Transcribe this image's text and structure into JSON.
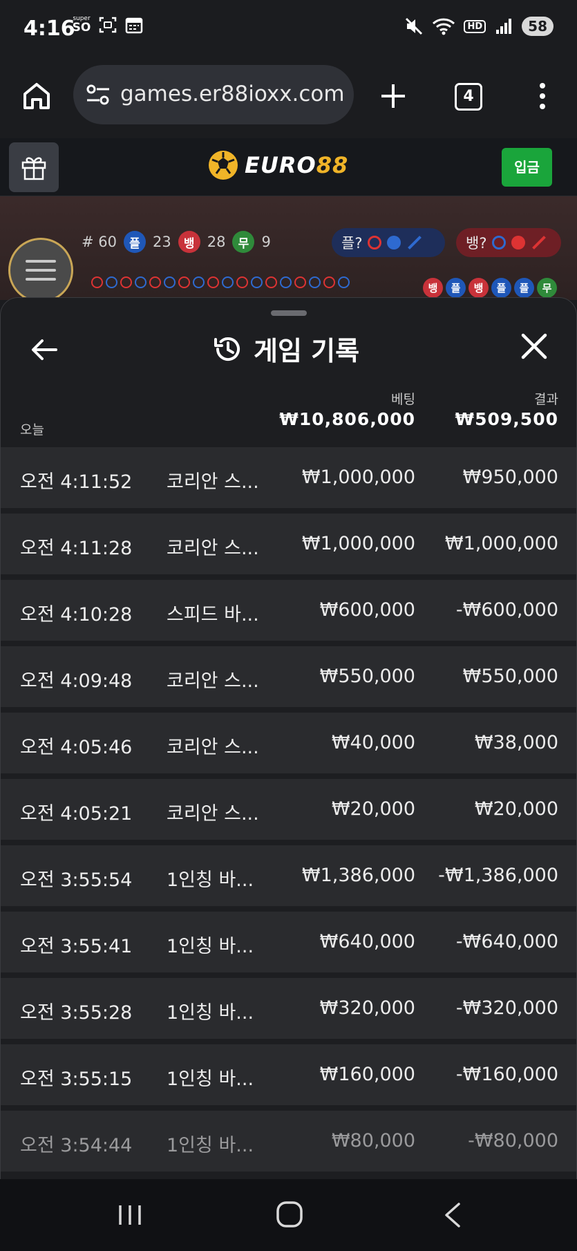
{
  "status": {
    "time": "4:16",
    "battery": "58",
    "hd": "HD",
    "super_label": "super",
    "icons": [
      "super-so-icon",
      "screenshot-icon",
      "calendar-icon",
      "mute-icon",
      "wifi-icon",
      "hd-icon",
      "signal-icon"
    ]
  },
  "browser": {
    "url": "games.er88ioxx.com",
    "tab_count": "4",
    "icons": [
      "home-icon",
      "site-settings-icon",
      "plus-icon",
      "more-vert-icon"
    ]
  },
  "site": {
    "logo_euro": "EURO",
    "logo_num": "88",
    "deposit_label": "입금",
    "colors": {
      "brand_gold": "#f0b428",
      "deposit_green": "#1aa53b"
    }
  },
  "game_strip": {
    "round": "# 60",
    "player_letter": "플",
    "player_count": "23",
    "banker_letter": "뱅",
    "banker_count": "28",
    "tie_letter": "무",
    "tie_count": "9",
    "player_predict": "플?",
    "banker_predict": "뱅?",
    "history_chips": [
      "뱅",
      "플",
      "뱅",
      "플",
      "플",
      "무"
    ]
  },
  "sheet": {
    "title": "게임 기록",
    "today_label": "오늘",
    "bet_header": "베팅",
    "result_header": "결과",
    "bet_total": "₩10,806,000",
    "result_total": "₩509,500",
    "rows": [
      {
        "time": "오전 4:11:52",
        "game": "코리안 스...",
        "bet": "₩1,000,000",
        "result": "₩950,000"
      },
      {
        "time": "오전 4:11:28",
        "game": "코리안 스...",
        "bet": "₩1,000,000",
        "result": "₩1,000,000"
      },
      {
        "time": "오전 4:10:28",
        "game": "스피드 바...",
        "bet": "₩600,000",
        "result": "-₩600,000"
      },
      {
        "time": "오전 4:09:48",
        "game": "코리안 스...",
        "bet": "₩550,000",
        "result": "₩550,000"
      },
      {
        "time": "오전 4:05:46",
        "game": "코리안 스...",
        "bet": "₩40,000",
        "result": "₩38,000"
      },
      {
        "time": "오전 4:05:21",
        "game": "코리안 스...",
        "bet": "₩20,000",
        "result": "₩20,000"
      },
      {
        "time": "오전 3:55:54",
        "game": "1인칭 바...",
        "bet": "₩1,386,000",
        "result": "-₩1,386,000"
      },
      {
        "time": "오전 3:55:41",
        "game": "1인칭 바...",
        "bet": "₩640,000",
        "result": "-₩640,000"
      },
      {
        "time": "오전 3:55:28",
        "game": "1인칭 바...",
        "bet": "₩320,000",
        "result": "-₩320,000"
      },
      {
        "time": "오전 3:55:15",
        "game": "1인칭 바...",
        "bet": "₩160,000",
        "result": "-₩160,000"
      },
      {
        "time": "오전 3:54:44",
        "game": "1인칭 바...",
        "bet": "₩80,000",
        "result": "-₩80,000"
      }
    ]
  },
  "nav": {
    "icons": [
      "recent-apps-icon",
      "home-nav-icon",
      "back-nav-icon"
    ]
  }
}
